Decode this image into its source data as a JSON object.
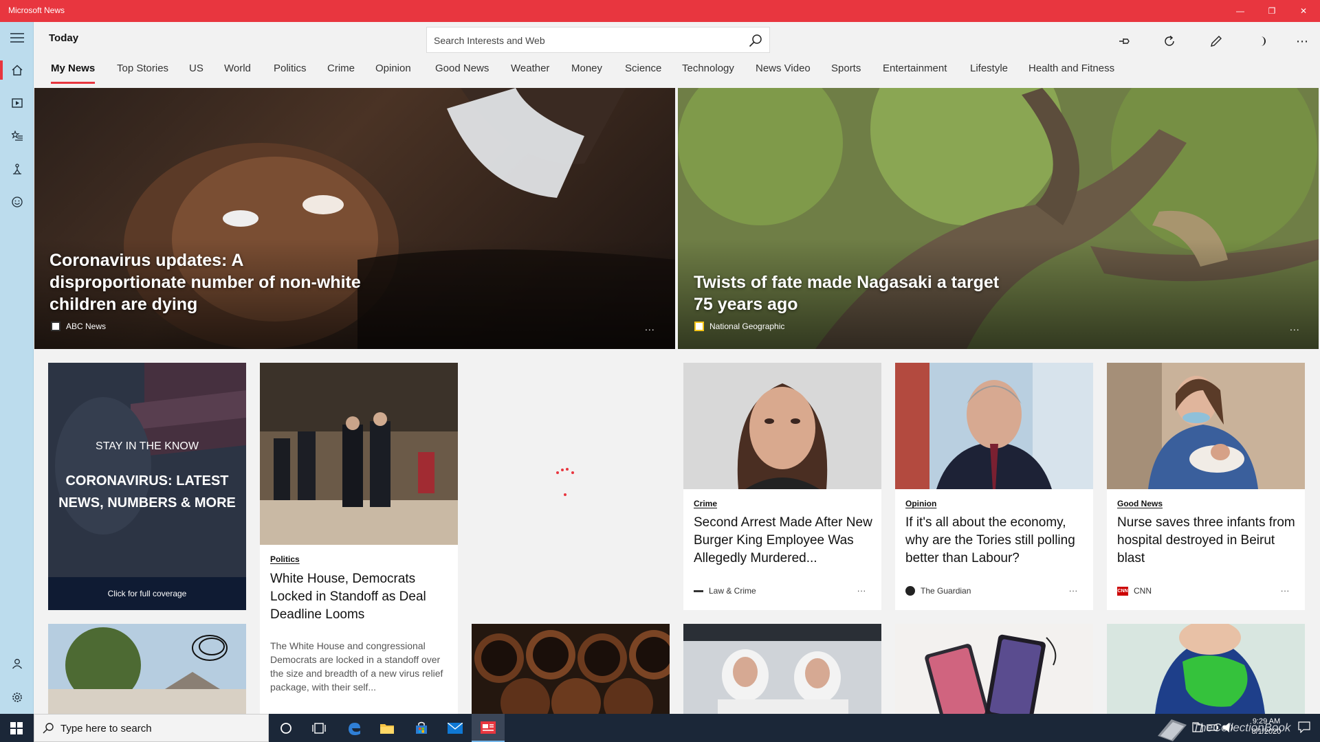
{
  "window": {
    "title": "Microsoft News"
  },
  "header": {
    "page_title": "Today",
    "search_placeholder": "Search Interests and Web"
  },
  "tabs": [
    {
      "label": "My News",
      "active": true
    },
    {
      "label": "Top Stories"
    },
    {
      "label": "US"
    },
    {
      "label": "World"
    },
    {
      "label": "Politics"
    },
    {
      "label": "Crime"
    },
    {
      "label": "Opinion"
    },
    {
      "label": "Good News"
    },
    {
      "label": "Weather"
    },
    {
      "label": "Money"
    },
    {
      "label": "Science"
    },
    {
      "label": "Technology"
    },
    {
      "label": "News Video"
    },
    {
      "label": "Sports"
    },
    {
      "label": "Entertainment"
    },
    {
      "label": "Lifestyle"
    },
    {
      "label": "Health and Fitness"
    }
  ],
  "heroes": [
    {
      "title": "Coronavirus updates: A disproportionate number of non-white children are dying",
      "source": "ABC News",
      "more": "..."
    },
    {
      "title": "Twists of fate made Nagasaki a target 75 years ago",
      "source": "National Geographic",
      "more": "..."
    }
  ],
  "coverage_card": {
    "kicker": "STAY IN THE KNOW",
    "headline": "CORONAVIRUS: LATEST NEWS, NUMBERS & MORE",
    "cta": "Click for full coverage"
  },
  "cards": [
    {
      "category": "Politics",
      "title": "White House, Democrats Locked in Standoff as Deal Deadline Looms",
      "description": "The White House and congressional Democrats are locked in a standoff over the size and breadth of a new virus relief package, with their self..."
    },
    {
      "category": "Crime",
      "title": "Second Arrest Made After New Burger King Employee Was Allegedly Murdered...",
      "source": "Law & Crime",
      "more": "..."
    },
    {
      "category": "Opinion",
      "title": "If it's all about the economy, why are the Tories still polling better than Labour?",
      "source": "The Guardian",
      "more": "..."
    },
    {
      "category": "Good News",
      "title": "Nurse saves three infants from hospital destroyed in Beirut blast",
      "source": "CNN",
      "more": "..."
    }
  ],
  "taskbar": {
    "search_placeholder": "Type here to search",
    "time": "9:29 AM",
    "date": "8/1/2020",
    "watermark": "TheCollectionBook"
  },
  "icons": {
    "menu": "hamburger-icon",
    "home": "home-icon",
    "video": "video-icon",
    "interests": "star-list-icon",
    "local": "local-icon",
    "emoji": "smiley-icon",
    "account": "person-icon",
    "settings": "gear-icon",
    "pin": "pin-icon",
    "refresh": "refresh-icon",
    "edit": "pencil-icon",
    "theme": "moon-icon",
    "more": "more-icon"
  },
  "colors": {
    "accent": "#e8363f",
    "rail": "#bcdced",
    "taskbar": "#1b2738"
  }
}
